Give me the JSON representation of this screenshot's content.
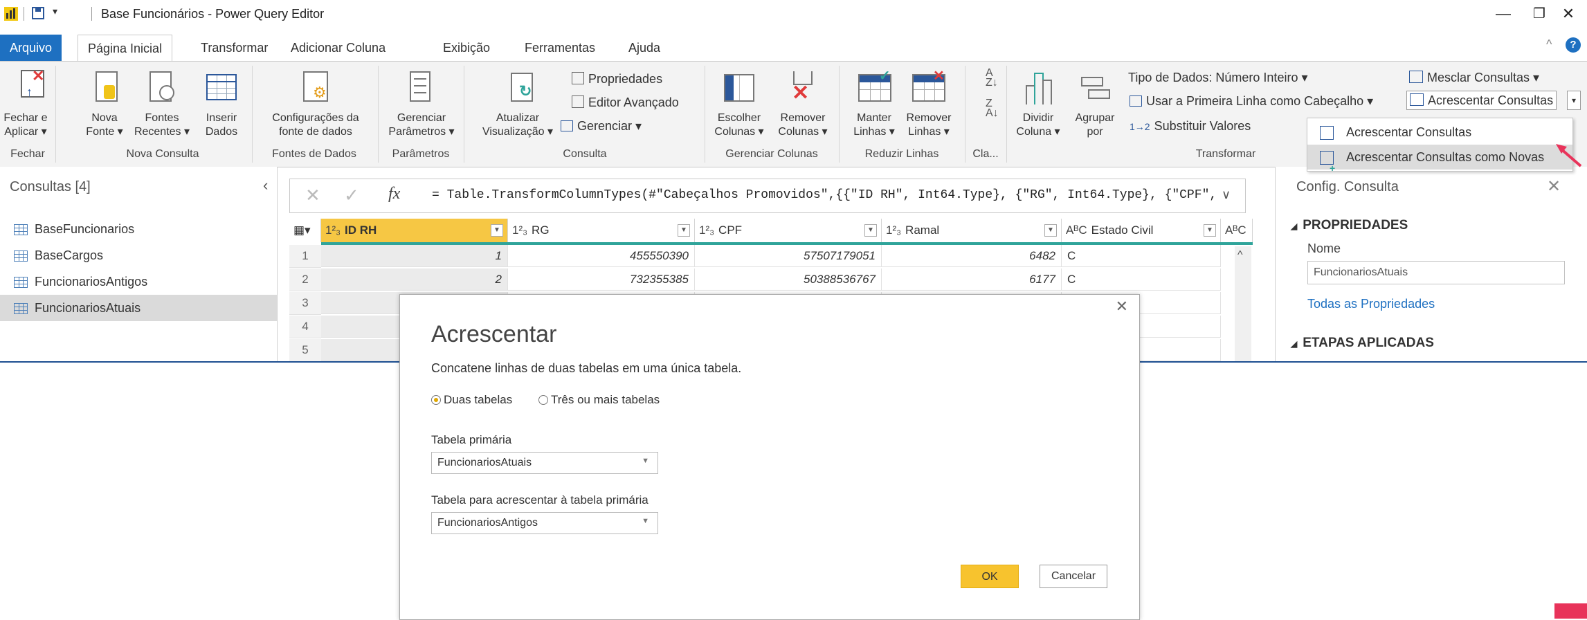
{
  "window": {
    "title": "Base Funcionários - Power Query Editor",
    "controls": {
      "minimize": "—",
      "restore": "❐",
      "close": "✕"
    }
  },
  "ribbon_tabs": [
    "Arquivo",
    "Página Inicial",
    "Transformar",
    "Adicionar Coluna",
    "Exibição",
    "Ferramentas",
    "Ajuda"
  ],
  "ribbon": {
    "fechar": {
      "btn": "Fechar e\nAplicar ▾",
      "group": "Fechar"
    },
    "nova_consulta": {
      "nova_fonte": "Nova\nFonte ▾",
      "fontes_recentes": "Fontes\nRecentes ▾",
      "inserir_dados": "Inserir\nDados",
      "group": "Nova Consulta"
    },
    "fontes": {
      "config": "Configurações da\nfonte de dados",
      "group": "Fontes de Dados"
    },
    "parametros": {
      "gerenciar": "Gerenciar\nParâmetros ▾",
      "group": "Parâmetros"
    },
    "consulta": {
      "atualizar": "Atualizar\nVisualização ▾",
      "propriedades": "Propriedades",
      "editor": "Editor Avançado",
      "gerenciar": "Gerenciar ▾",
      "group": "Consulta"
    },
    "colunas": {
      "escolher": "Escolher\nColunas ▾",
      "remover": "Remover\nColunas ▾",
      "group": "Gerenciar Colunas"
    },
    "linhas": {
      "manter": "Manter\nLinhas ▾",
      "remover": "Remover\nLinhas ▾",
      "group": "Reduzir Linhas"
    },
    "classificar": {
      "group": "Cla..."
    },
    "transformar": {
      "dividir": "Dividir\nColuna ▾",
      "agrupar": "Agrupar\npor",
      "tipo": "Tipo de Dados: Número Inteiro ▾",
      "primeira_linha": "Usar a Primeira Linha como Cabeçalho ▾",
      "substituir": "Substituir Valores",
      "group": "Transformar"
    },
    "combinar": {
      "mesclar": "Mesclar Consultas ▾",
      "acrescentar": "Acrescentar Consultas"
    }
  },
  "menu": [
    "Acrescentar Consultas",
    "Acrescentar Consultas como Novas"
  ],
  "queries": {
    "header": "Consultas [4]",
    "items": [
      "BaseFuncionarios",
      "BaseCargos",
      "FuncionariosAntigos",
      "FuncionariosAtuais"
    ]
  },
  "formula": {
    "fx": "fx",
    "text": "= Table.TransformColumnTypes(#\"Cabeçalhos Promovidos\",{{\"ID RH\", Int64.Type}, {\"RG\", Int64.Type}, {\"CPF\","
  },
  "grid": {
    "headers": [
      {
        "type": "1²₃",
        "name": "ID RH"
      },
      {
        "type": "1²₃",
        "name": "RG"
      },
      {
        "type": "1²₃",
        "name": "CPF"
      },
      {
        "type": "1²₃",
        "name": "Ramal"
      },
      {
        "type": "AᴮC",
        "name": "Estado Civil"
      },
      {
        "type": "AᴮC",
        "name": ""
      }
    ],
    "rows": [
      {
        "n": "1",
        "id": "1",
        "rg": "455550390",
        "cpf": "57507179051",
        "ramal": "6482",
        "ec": "C"
      },
      {
        "n": "2",
        "id": "2",
        "rg": "732355385",
        "cpf": "50388536767",
        "ramal": "6177",
        "ec": "C"
      },
      {
        "n": "3",
        "id": "",
        "rg": "",
        "cpf": "",
        "ramal": "",
        "ec": ""
      },
      {
        "n": "4",
        "id": "",
        "rg": "",
        "cpf": "",
        "ramal": "",
        "ec": ""
      },
      {
        "n": "5",
        "id": "",
        "rg": "",
        "cpf": "",
        "ramal": "",
        "ec": ""
      }
    ]
  },
  "settings": {
    "title": "Config. Consulta",
    "propriedades": "PROPRIEDADES",
    "nome_label": "Nome",
    "nome_value": "FuncionariosAtuais",
    "todas": "Todas as Propriedades",
    "etapas": "ETAPAS APLICADAS"
  },
  "dialog": {
    "title": "Acrescentar",
    "desc": "Concatene linhas de duas tabelas em uma única tabela.",
    "opt1": "Duas tabelas",
    "opt2": "Três ou mais tabelas",
    "primary_label": "Tabela primária",
    "primary_value": "FuncionariosAtuais",
    "append_label": "Tabela para acrescentar à tabela primária",
    "append_value": "FuncionariosAntigos",
    "ok": "OK",
    "cancel": "Cancelar",
    "close": "✕"
  },
  "colors": {
    "accent": "#1e70c1",
    "ok": "#f7c32e",
    "pointer": "#e8335a",
    "teal": "#2fa49a"
  }
}
